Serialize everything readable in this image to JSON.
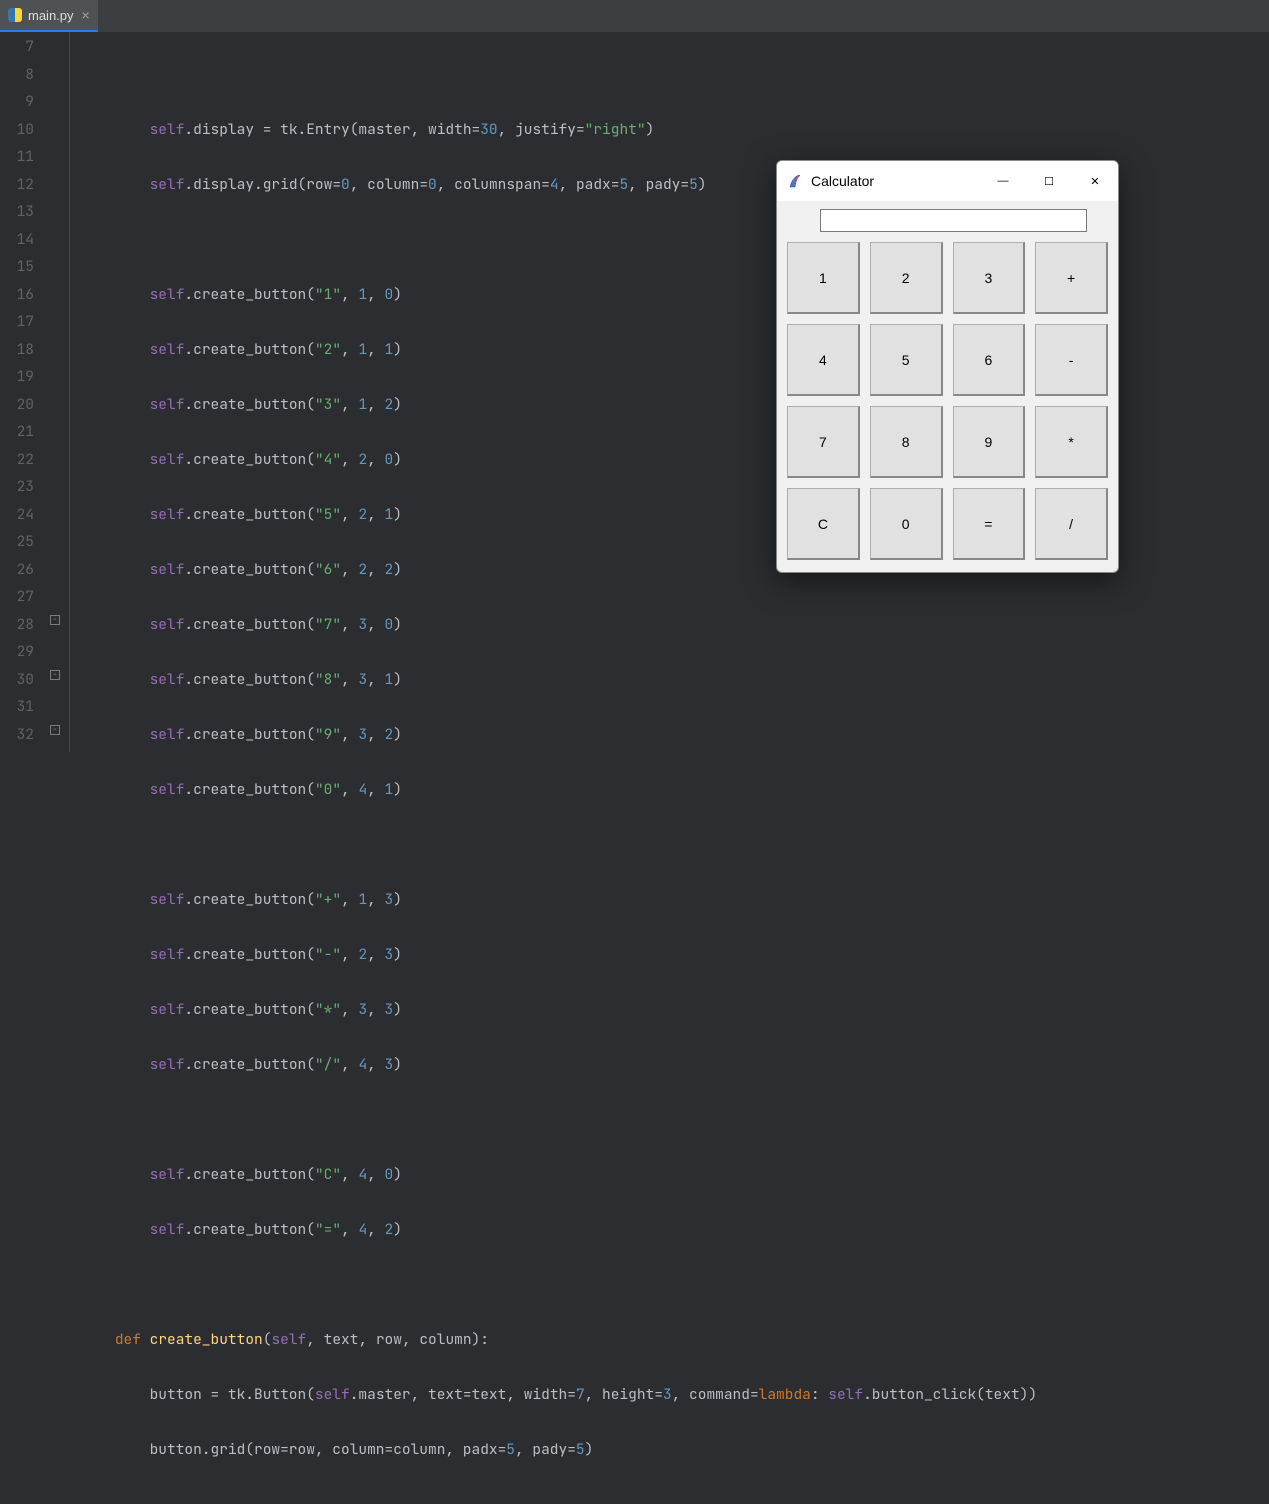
{
  "tab": {
    "filename": "main.py",
    "close_glyph": "×"
  },
  "gutter": [
    "7",
    "8",
    "9",
    "10",
    "11",
    "12",
    "13",
    "14",
    "15",
    "16",
    "17",
    "18",
    "19",
    "20",
    "21",
    "22",
    "23",
    "24",
    "25",
    "26",
    "27",
    "28",
    "29",
    "30",
    "31",
    "32"
  ],
  "code": {
    "l8": {
      "a": "        ",
      "b": "self",
      "c": ".display = tk.Entry(master, width=",
      "d": "30",
      "e": ", justify=",
      "f": "\"right\"",
      "g": ")"
    },
    "l9": {
      "a": "        ",
      "b": "self",
      "c": ".display.grid(row=",
      "d": "0",
      "e": ", column=",
      "f": "0",
      "g": ", columnspan=",
      "h": "4",
      "i": ", padx=",
      "j": "5",
      "k": ", pady=",
      "l": "5",
      "m": ")"
    },
    "l11": {
      "a": "        ",
      "b": "self",
      "c": ".create_button(",
      "d": "\"1\"",
      "e": ", ",
      "f": "1",
      "g": ", ",
      "h": "0",
      "i": ")"
    },
    "l12": {
      "a": "        ",
      "b": "self",
      "c": ".create_button(",
      "d": "\"2\"",
      "e": ", ",
      "f": "1",
      "g": ", ",
      "h": "1",
      "i": ")"
    },
    "l13": {
      "a": "        ",
      "b": "self",
      "c": ".create_button(",
      "d": "\"3\"",
      "e": ", ",
      "f": "1",
      "g": ", ",
      "h": "2",
      "i": ")"
    },
    "l14": {
      "a": "        ",
      "b": "self",
      "c": ".create_button(",
      "d": "\"4\"",
      "e": ", ",
      "f": "2",
      "g": ", ",
      "h": "0",
      "i": ")"
    },
    "l15": {
      "a": "        ",
      "b": "self",
      "c": ".create_button(",
      "d": "\"5\"",
      "e": ", ",
      "f": "2",
      "g": ", ",
      "h": "1",
      "i": ")"
    },
    "l16": {
      "a": "        ",
      "b": "self",
      "c": ".create_button(",
      "d": "\"6\"",
      "e": ", ",
      "f": "2",
      "g": ", ",
      "h": "2",
      "i": ")"
    },
    "l17": {
      "a": "        ",
      "b": "self",
      "c": ".create_button(",
      "d": "\"7\"",
      "e": ", ",
      "f": "3",
      "g": ", ",
      "h": "0",
      "i": ")"
    },
    "l18": {
      "a": "        ",
      "b": "self",
      "c": ".create_button(",
      "d": "\"8\"",
      "e": ", ",
      "f": "3",
      "g": ", ",
      "h": "1",
      "i": ")"
    },
    "l19": {
      "a": "        ",
      "b": "self",
      "c": ".create_button(",
      "d": "\"9\"",
      "e": ", ",
      "f": "3",
      "g": ", ",
      "h": "2",
      "i": ")"
    },
    "l20": {
      "a": "        ",
      "b": "self",
      "c": ".create_button(",
      "d": "\"0\"",
      "e": ", ",
      "f": "4",
      "g": ", ",
      "h": "1",
      "i": ")"
    },
    "l22": {
      "a": "        ",
      "b": "self",
      "c": ".create_button(",
      "d": "\"+\"",
      "e": ", ",
      "f": "1",
      "g": ", ",
      "h": "3",
      "i": ")"
    },
    "l23": {
      "a": "        ",
      "b": "self",
      "c": ".create_button(",
      "d": "\"-\"",
      "e": ", ",
      "f": "2",
      "g": ", ",
      "h": "3",
      "i": ")"
    },
    "l24": {
      "a": "        ",
      "b": "self",
      "c": ".create_button(",
      "d": "\"*\"",
      "e": ", ",
      "f": "3",
      "g": ", ",
      "h": "3",
      "i": ")"
    },
    "l25": {
      "a": "        ",
      "b": "self",
      "c": ".create_button(",
      "d": "\"/\"",
      "e": ", ",
      "f": "4",
      "g": ", ",
      "h": "3",
      "i": ")"
    },
    "l27": {
      "a": "        ",
      "b": "self",
      "c": ".create_button(",
      "d": "\"C\"",
      "e": ", ",
      "f": "4",
      "g": ", ",
      "h": "0",
      "i": ")"
    },
    "l28": {
      "a": "        ",
      "b": "self",
      "c": ".create_button(",
      "d": "\"=\"",
      "e": ", ",
      "f": "4",
      "g": ", ",
      "h": "2",
      "i": ")"
    },
    "l30": {
      "a": "    ",
      "b": "def ",
      "c": "create_button",
      "d": "(",
      "e": "self",
      "f": ", text, row, column):"
    },
    "l31": {
      "a": "        button = tk.Button(",
      "b": "self",
      "c": ".master, text=text, width=",
      "d": "7",
      "e": ", height=",
      "f": "3",
      "g": ", command=",
      "h": "lambda",
      "i": ": ",
      "j": "self",
      "k": ".button_click(text))"
    },
    "l32": {
      "a": "        button.grid(row=row, column=column, padx=",
      "b": "5",
      "c": ", pady=",
      "d": "5",
      "e": ")"
    }
  },
  "calc": {
    "title": "Calculator",
    "entry_value": "",
    "buttons": [
      "1",
      "2",
      "3",
      "+",
      "4",
      "5",
      "6",
      "-",
      "7",
      "8",
      "9",
      "*",
      "C",
      "0",
      "=",
      "/"
    ]
  },
  "win_controls": {
    "min": "—",
    "max": "☐",
    "close": "✕"
  }
}
